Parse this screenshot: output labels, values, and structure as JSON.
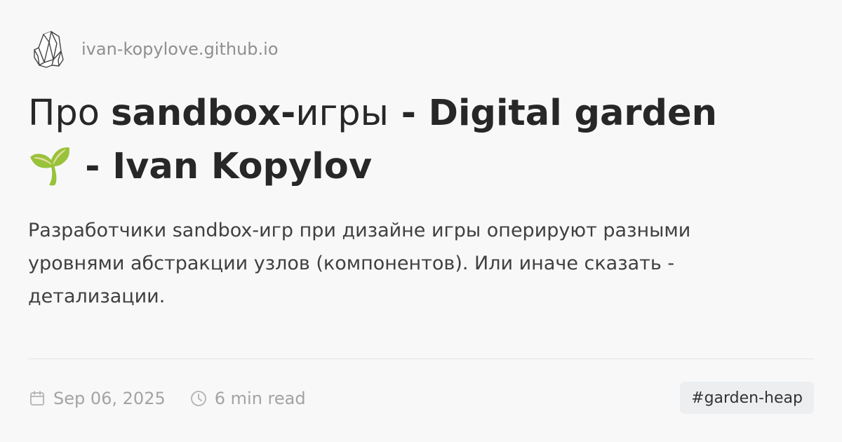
{
  "site": {
    "logo_icon": "crystal-cluster-icon",
    "name": "ivan-kopylove.github.io"
  },
  "title": {
    "prefix": "Про ",
    "bold_part_1": "sandbox-",
    "regular_part": "игры",
    "bold_part_2": " - Digital garden",
    "emoji": "🌱",
    "bold_part_3": " - Ivan Kopylov"
  },
  "description": {
    "line_1": "Разработчики sandbox-игр при дизайне игры оперируют разными",
    "line_2": "уровнями абстракции узлов (компонентов). Или иначе сказать -",
    "line_3": "детализации."
  },
  "meta": {
    "date_icon": "calendar-icon",
    "date": "Sep 06, 2025",
    "read_icon": "clock-icon",
    "read_time": "6 min read",
    "tag": "#garden-heap"
  },
  "colors": {
    "background": "#f8f8f9",
    "title": "#272727",
    "muted": "#a3a3a3",
    "tag_background": "#eceef0"
  }
}
